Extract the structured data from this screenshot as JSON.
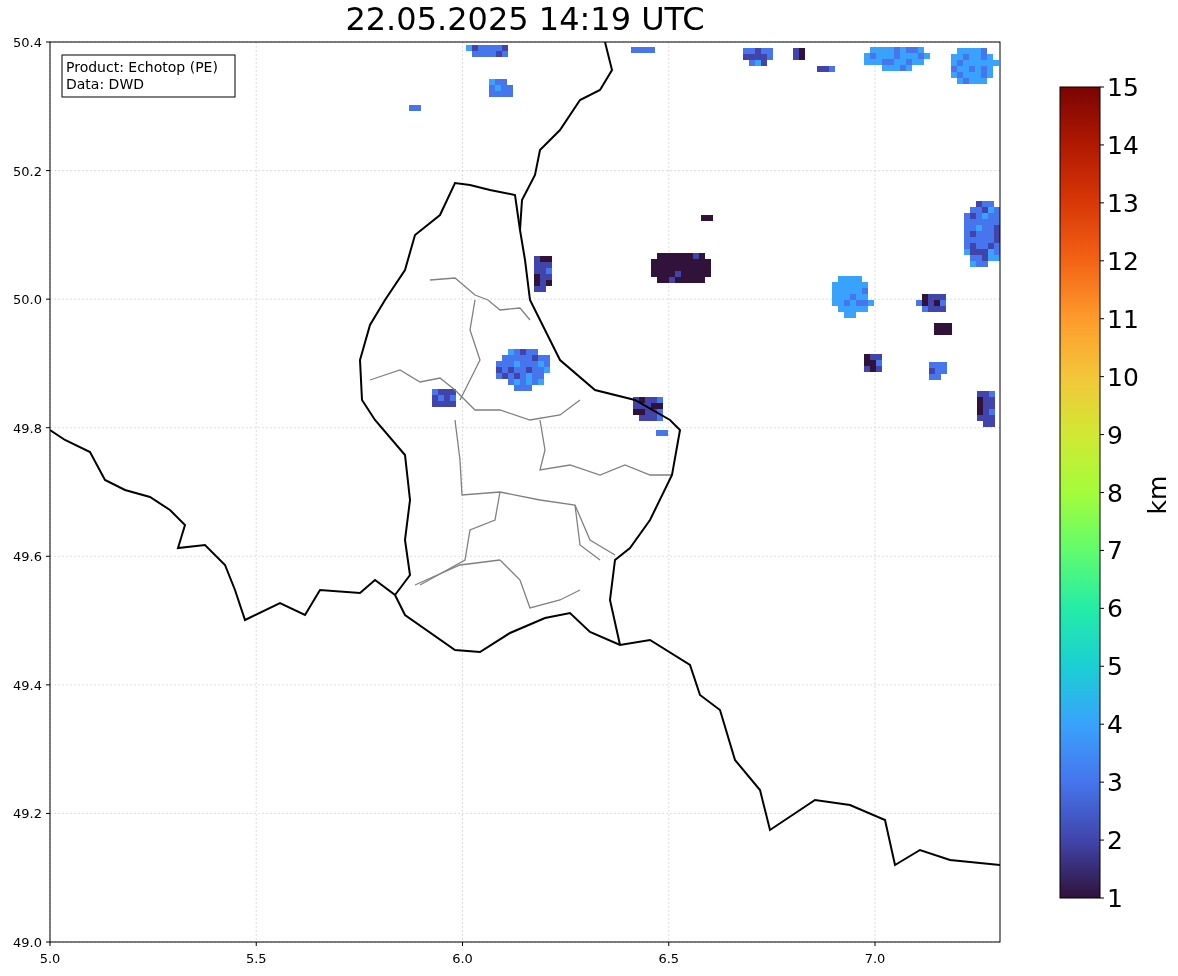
{
  "title": "22.05.2025 14:19 UTC",
  "info_box": {
    "lines": [
      "Product: Echotop (PE)",
      "Data: DWD"
    ]
  },
  "map": {
    "x_ticks": [
      "5.0",
      "5.5",
      "6.0",
      "6.5",
      "7.0"
    ],
    "y_ticks": [
      "50.4",
      "50.2",
      "50.0",
      "49.8",
      "49.6",
      "49.4",
      "49.2",
      "49.0"
    ]
  },
  "colorbar": {
    "label": "km",
    "ticks": [
      "15",
      "14",
      "13",
      "12",
      "11",
      "10",
      "9",
      "8",
      "7",
      "6",
      "5",
      "4",
      "3",
      "2",
      "1"
    ]
  }
}
